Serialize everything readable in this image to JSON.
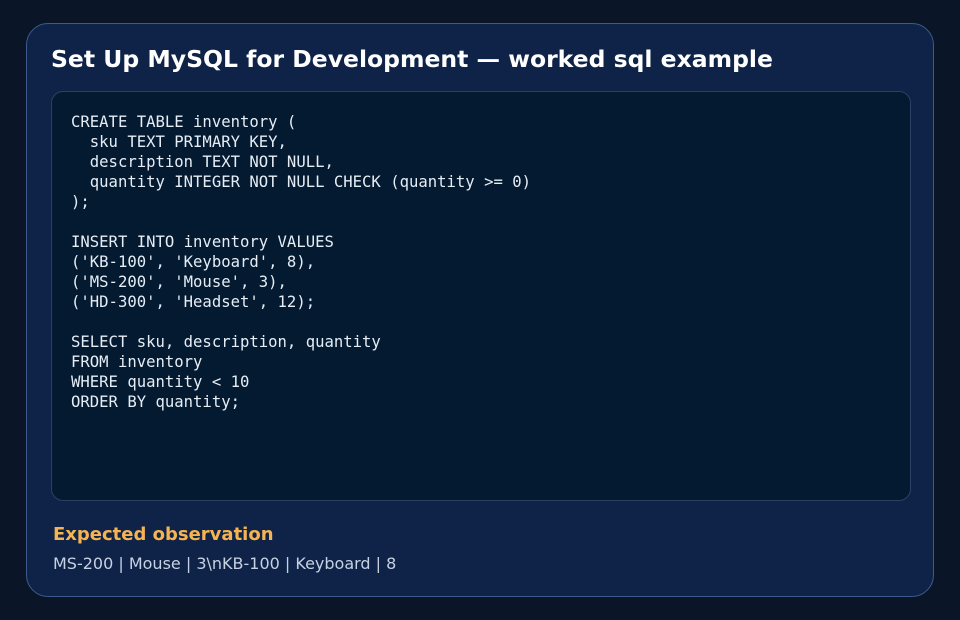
{
  "title": "Set Up MySQL for Development — worked sql example",
  "code": "CREATE TABLE inventory (\n  sku TEXT PRIMARY KEY,\n  description TEXT NOT NULL,\n  quantity INTEGER NOT NULL CHECK (quantity >= 0)\n);\n\nINSERT INTO inventory VALUES\n('KB-100', 'Keyboard', 8),\n('MS-200', 'Mouse', 3),\n('HD-300', 'Headset', 12);\n\nSELECT sku, description, quantity\nFROM inventory\nWHERE quantity < 10\nORDER BY quantity;",
  "observation": {
    "label": "Expected observation",
    "text": "MS-200 | Mouse | 3\\nKB-100 | Keyboard | 8"
  },
  "colors": {
    "background": "#0a1628",
    "card": "#0e2347",
    "code_panel": "#041a31",
    "accent": "#f5b451"
  }
}
